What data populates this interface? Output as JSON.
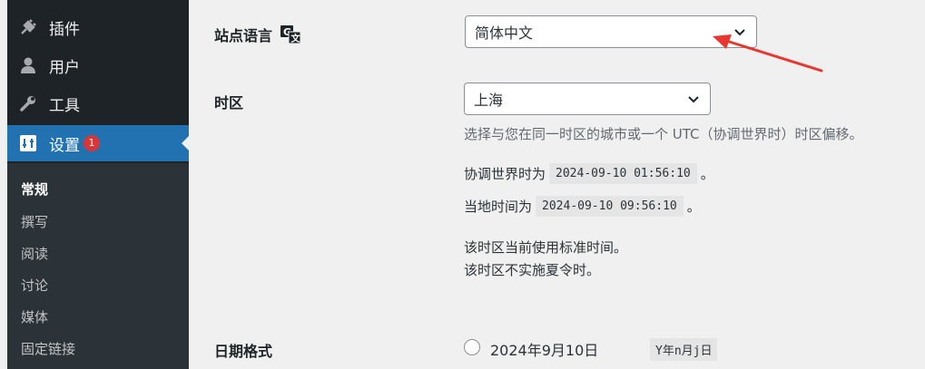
{
  "sidebar": {
    "items": [
      {
        "label": "插件",
        "icon": "plugin-icon"
      },
      {
        "label": "用户",
        "icon": "user-icon"
      },
      {
        "label": "工具",
        "icon": "wrench-icon"
      },
      {
        "label": "设置",
        "icon": "settings-icon",
        "badge": "1"
      }
    ],
    "submenu": [
      "常规",
      "撰写",
      "阅读",
      "讨论",
      "媒体",
      "固定链接"
    ]
  },
  "settings": {
    "site_language": {
      "label": "站点语言",
      "icon": "translation-icon",
      "value": "简体中文"
    },
    "timezone": {
      "label": "时区",
      "value": "上海",
      "description": "选择与您在同一时区的城市或一个 UTC（协调世界时）时区偏移。",
      "utc_prefix": "协调世界时为",
      "utc_time": "2024-09-10 01:56:10",
      "utc_suffix": "。",
      "local_prefix": "当地时间为",
      "local_time": "2024-09-10 09:56:10",
      "local_suffix": "。",
      "note1": "该时区当前使用标准时间。",
      "note2": "该时区不实施夏令时。"
    },
    "date_format": {
      "label": "日期格式",
      "options": [
        {
          "label": "2024年9月10日",
          "code": "Y年n月j日"
        }
      ]
    }
  },
  "colors": {
    "sidebar": "#1d2327",
    "active": "#2271b1",
    "badge": "#d63638",
    "arrow": "#e8372f"
  }
}
